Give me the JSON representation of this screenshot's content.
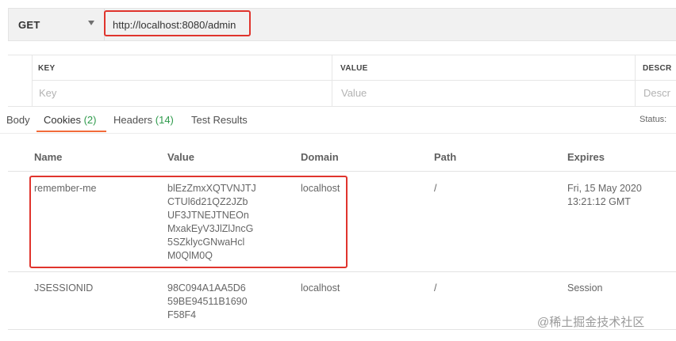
{
  "request": {
    "method": "GET",
    "url": "http://localhost:8080/admin"
  },
  "params": {
    "headers": [
      "KEY",
      "VALUE",
      "DESCR"
    ],
    "placeholders": [
      "Key",
      "Value",
      "Descr"
    ]
  },
  "response_tabs": [
    {
      "label": "Body",
      "count": ""
    },
    {
      "label": "Cookies",
      "count": "(2)"
    },
    {
      "label": "Headers",
      "count": "(14)"
    },
    {
      "label": "Test Results",
      "count": ""
    }
  ],
  "status_label": "Status:",
  "cookies": {
    "columns": [
      "Name",
      "Value",
      "Domain",
      "Path",
      "Expires"
    ],
    "rows": [
      {
        "name": "remember-me",
        "value": "blEzZmxXQTVNJTJ\nCTUl6d21QZ2JZb\nUF3JTNEJTNEOn\nMxakEyV3JlZlJncG\n5SZklycGNwaHcl\nM0QlM0Q",
        "domain": "localhost",
        "path": "/",
        "expires": "Fri, 15 May 2020\n13:21:12 GMT"
      },
      {
        "name": "JSESSIONID",
        "value": "98C094A1AA5D6\n59BE94511B1690\nF58F4",
        "domain": "localhost",
        "path": "/",
        "expires": "Session"
      }
    ]
  },
  "watermark": "@稀土掘金技术社区",
  "colors": {
    "highlight": "#e0342d",
    "active_tab": "#f26b3a",
    "count": "#2e9a4b"
  }
}
